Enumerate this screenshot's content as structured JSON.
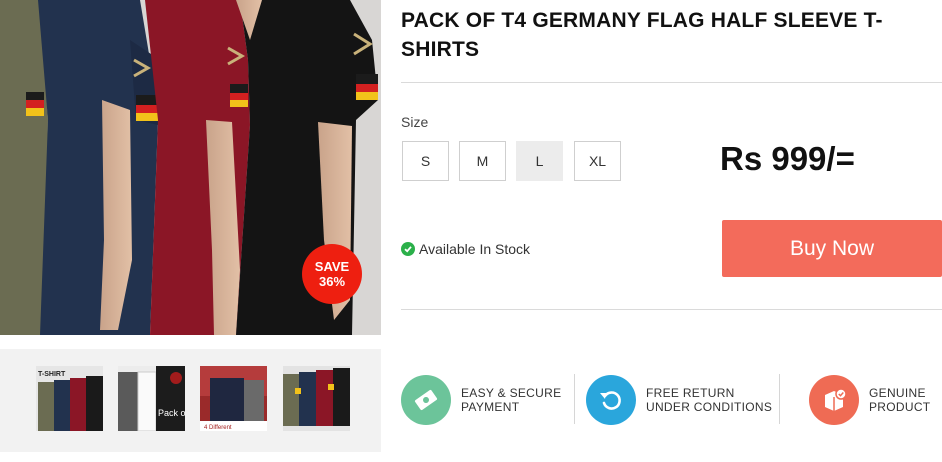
{
  "product": {
    "title": "PACK OF T4 GERMANY FLAG HALF SLEEVE T-SHIRTS",
    "image_alt": "Four men wearing olive, navy, maroon and black t-shirts with Germany flag sleeves",
    "save_badge": {
      "line1": "SAVE",
      "line2": "36%"
    },
    "thumbnails": [
      {
        "name": "thumbnail-1",
        "caption": "T-SHIRT"
      },
      {
        "name": "thumbnail-2",
        "caption": "Pack of 3"
      },
      {
        "name": "thumbnail-3",
        "caption": "4 Different"
      },
      {
        "name": "thumbnail-4",
        "caption": ""
      }
    ]
  },
  "size": {
    "label": "Size",
    "options": [
      "S",
      "M",
      "L",
      "XL"
    ],
    "selected": "L"
  },
  "price": "Rs 999/=",
  "stock": {
    "text": "Available In Stock",
    "color": "#2bb04a"
  },
  "buy_button": {
    "label": "Buy Now",
    "color": "#f36b5b"
  },
  "features": [
    {
      "line1": "EASY & SECURE",
      "line2": "PAYMENT",
      "icon": "payment-icon",
      "color": "#6cc49a"
    },
    {
      "line1": "FREE RETURN",
      "line2": "UNDER CONDITIONS",
      "icon": "return-icon",
      "color": "#2aa6dc"
    },
    {
      "line1": "GENUINE",
      "line2": "PRODUCT",
      "icon": "genuine-box-icon",
      "color": "#ef6b54"
    }
  ],
  "colors": {
    "badge": "#ee1f10",
    "accent": "#f36b5b"
  }
}
